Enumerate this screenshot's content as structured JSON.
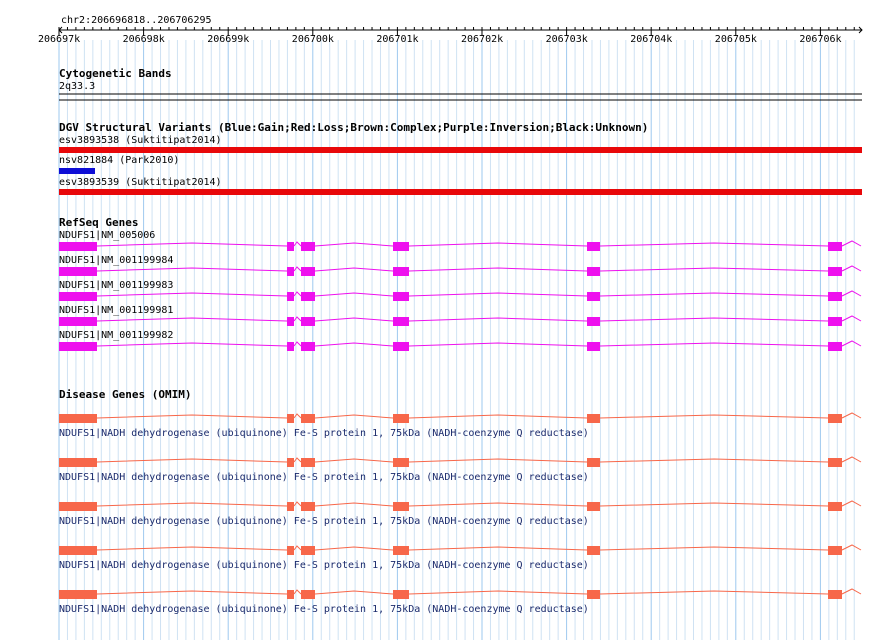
{
  "location": "chr2:206696818..206706295",
  "ruler": {
    "ticks": [
      "206697k",
      "206698k",
      "206699k",
      "206700k",
      "206701k",
      "206702k",
      "206703k",
      "206704k",
      "206705k",
      "206706k"
    ]
  },
  "colors": {
    "grid_major": "#9ec9ef",
    "grid_minor": "#cfe2f3",
    "dgv_red": "#e8080a",
    "dgv_blue": "#0d0dd6",
    "refseq": "#ee10ee",
    "omim": "#f7674a",
    "text_navy": "#1a2a6c"
  },
  "cyto": {
    "title": "Cytogenetic Bands",
    "band": "2q33.3"
  },
  "dgv": {
    "title": "DGV Structural Variants (Blue:Gain;Red:Loss;Brown:Complex;Purple:Inversion;Black:Unknown)",
    "items": [
      {
        "label": "esv3893538 (Suktitipat2014)",
        "type": "loss"
      },
      {
        "label": "nsv821884 (Park2010)",
        "type": "gain"
      },
      {
        "label": "esv3893539 (Suktitipat2014)",
        "type": "loss"
      }
    ]
  },
  "refseq": {
    "title": "RefSeq Genes",
    "items": [
      {
        "label": "NDUFS1|NM_005006"
      },
      {
        "label": "NDUFS1|NM_001199984"
      },
      {
        "label": "NDUFS1|NM_001199983"
      },
      {
        "label": "NDUFS1|NM_001199981"
      },
      {
        "label": "NDUFS1|NM_001199982"
      }
    ]
  },
  "omim": {
    "title": "Disease Genes (OMIM)",
    "items": [
      {
        "label": "NDUFS1|NADH dehydrogenase (ubiquinone) Fe-S protein 1, 75kDa (NADH-coenzyme Q reductase)"
      },
      {
        "label": "NDUFS1|NADH dehydrogenase (ubiquinone) Fe-S protein 1, 75kDa (NADH-coenzyme Q reductase)"
      },
      {
        "label": "NDUFS1|NADH dehydrogenase (ubiquinone) Fe-S protein 1, 75kDa (NADH-coenzyme Q reductase)"
      },
      {
        "label": "NDUFS1|NADH dehydrogenase (ubiquinone) Fe-S protein 1, 75kDa (NADH-coenzyme Q reductase)"
      },
      {
        "label": "NDUFS1|NADH dehydrogenase (ubiquinone) Fe-S protein 1, 75kDa (NADH-coenzyme Q reductase)"
      }
    ]
  }
}
